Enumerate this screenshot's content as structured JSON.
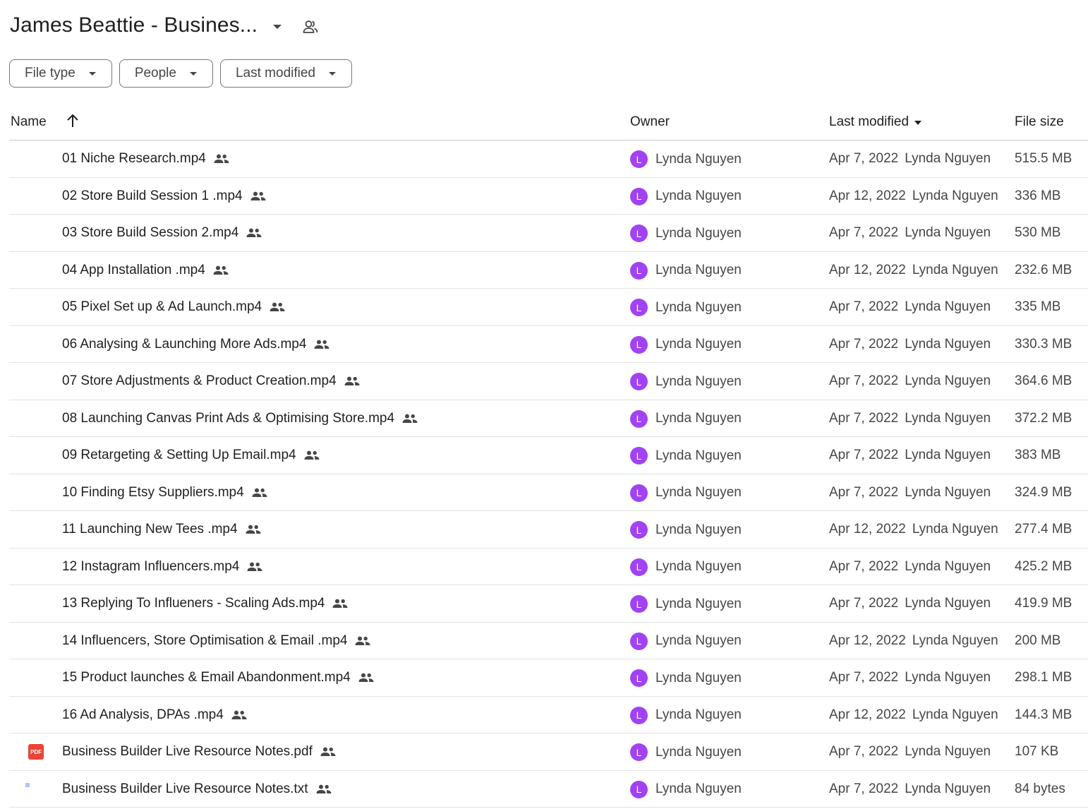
{
  "header": {
    "title": "James Beattie - Busines...",
    "caret_icon": "arrow-drop-down-icon",
    "shared_icon": "shared-people-icon"
  },
  "filters": [
    {
      "label": "File type"
    },
    {
      "label": "People"
    },
    {
      "label": "Last modified"
    }
  ],
  "columns": {
    "name": "Name",
    "sort_icon": "arrow-up-icon",
    "owner": "Owner",
    "last_modified": "Last modified",
    "file_size": "File size"
  },
  "colors": {
    "avatar": "#a142f4",
    "video": "#ea4335",
    "pdf": "#ea4335",
    "doc": "#4285f4"
  },
  "files": [
    {
      "name": "01 Niche Research.mp4",
      "type": "video",
      "owner": "Lynda Nguyen",
      "avatar": "L",
      "modified": "Apr 7, 2022",
      "modified_by": "Lynda Nguyen",
      "size": "515.5 MB"
    },
    {
      "name": "02 Store Build Session 1 .mp4",
      "type": "video",
      "owner": "Lynda Nguyen",
      "avatar": "L",
      "modified": "Apr 12, 2022",
      "modified_by": "Lynda Nguyen",
      "size": "336 MB"
    },
    {
      "name": "03 Store Build Session 2.mp4",
      "type": "video",
      "owner": "Lynda Nguyen",
      "avatar": "L",
      "modified": "Apr 7, 2022",
      "modified_by": "Lynda Nguyen",
      "size": "530 MB"
    },
    {
      "name": "04 App Installation .mp4",
      "type": "video",
      "owner": "Lynda Nguyen",
      "avatar": "L",
      "modified": "Apr 12, 2022",
      "modified_by": "Lynda Nguyen",
      "size": "232.6 MB"
    },
    {
      "name": "05 Pixel Set up & Ad Launch.mp4",
      "type": "video",
      "owner": "Lynda Nguyen",
      "avatar": "L",
      "modified": "Apr 7, 2022",
      "modified_by": "Lynda Nguyen",
      "size": "335 MB"
    },
    {
      "name": "06 Analysing & Launching More Ads.mp4",
      "type": "video",
      "owner": "Lynda Nguyen",
      "avatar": "L",
      "modified": "Apr 7, 2022",
      "modified_by": "Lynda Nguyen",
      "size": "330.3 MB"
    },
    {
      "name": "07 Store Adjustments & Product Creation.mp4",
      "type": "video",
      "owner": "Lynda Nguyen",
      "avatar": "L",
      "modified": "Apr 7, 2022",
      "modified_by": "Lynda Nguyen",
      "size": "364.6 MB"
    },
    {
      "name": "08 Launching Canvas Print Ads & Optimising Store.mp4",
      "type": "video",
      "owner": "Lynda Nguyen",
      "avatar": "L",
      "modified": "Apr 7, 2022",
      "modified_by": "Lynda Nguyen",
      "size": "372.2 MB"
    },
    {
      "name": "09 Retargeting & Setting Up Email.mp4",
      "type": "video",
      "owner": "Lynda Nguyen",
      "avatar": "L",
      "modified": "Apr 7, 2022",
      "modified_by": "Lynda Nguyen",
      "size": "383 MB"
    },
    {
      "name": "10 Finding Etsy Suppliers.mp4",
      "type": "video",
      "owner": "Lynda Nguyen",
      "avatar": "L",
      "modified": "Apr 7, 2022",
      "modified_by": "Lynda Nguyen",
      "size": "324.9 MB"
    },
    {
      "name": "11 Launching New Tees .mp4",
      "type": "video",
      "owner": "Lynda Nguyen",
      "avatar": "L",
      "modified": "Apr 12, 2022",
      "modified_by": "Lynda Nguyen",
      "size": "277.4 MB"
    },
    {
      "name": "12 Instagram Influencers.mp4",
      "type": "video",
      "owner": "Lynda Nguyen",
      "avatar": "L",
      "modified": "Apr 7, 2022",
      "modified_by": "Lynda Nguyen",
      "size": "425.2 MB"
    },
    {
      "name": "13 Replying To Influeners - Scaling Ads.mp4",
      "type": "video",
      "owner": "Lynda Nguyen",
      "avatar": "L",
      "modified": "Apr 7, 2022",
      "modified_by": "Lynda Nguyen",
      "size": "419.9 MB"
    },
    {
      "name": "14 Influencers, Store Optimisation & Email .mp4",
      "type": "video",
      "owner": "Lynda Nguyen",
      "avatar": "L",
      "modified": "Apr 12, 2022",
      "modified_by": "Lynda Nguyen",
      "size": "200 MB"
    },
    {
      "name": "15 Product launches & Email Abandonment.mp4",
      "type": "video",
      "owner": "Lynda Nguyen",
      "avatar": "L",
      "modified": "Apr 7, 2022",
      "modified_by": "Lynda Nguyen",
      "size": "298.1 MB"
    },
    {
      "name": "16 Ad Analysis, DPAs .mp4",
      "type": "video",
      "owner": "Lynda Nguyen",
      "avatar": "L",
      "modified": "Apr 12, 2022",
      "modified_by": "Lynda Nguyen",
      "size": "144.3 MB"
    },
    {
      "name": "Business Builder Live Resource Notes.pdf",
      "type": "pdf",
      "pdf_label": "PDF",
      "owner": "Lynda Nguyen",
      "avatar": "L",
      "modified": "Apr 7, 2022",
      "modified_by": "Lynda Nguyen",
      "size": "107 KB"
    },
    {
      "name": "Business Builder Live Resource Notes.txt",
      "type": "doc",
      "owner": "Lynda Nguyen",
      "avatar": "L",
      "modified": "Apr 7, 2022",
      "modified_by": "Lynda Nguyen",
      "size": "84 bytes"
    }
  ]
}
